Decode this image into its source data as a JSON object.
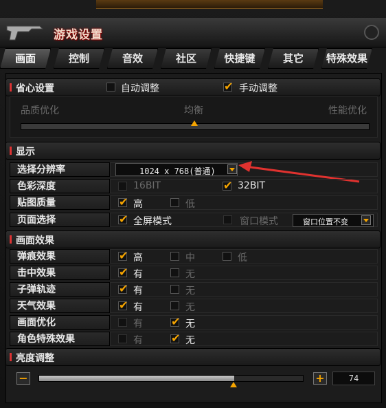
{
  "window": {
    "title": "游戏设置"
  },
  "tabs": [
    "画面",
    "控制",
    "音效",
    "社区",
    "快捷键",
    "其它",
    "特殊效果"
  ],
  "preset": {
    "header": "省心设置",
    "auto_label": "自动调整",
    "manual_label": "手动调整",
    "auto_checked": false,
    "manual_checked": true,
    "quality_label": "品质优化",
    "balance_label": "均衡",
    "performance_label": "性能优化",
    "slider_level": 0.5
  },
  "display": {
    "header": "显示",
    "resolution_label": "选择分辨率",
    "resolution_value": "1024 x 768(普通)",
    "color_depth_label": "色彩深度",
    "color_16": "16BIT",
    "color_32": "32BIT",
    "texture_label": "贴图质量",
    "texture_high": "高",
    "texture_low": "低",
    "screen_mode_label": "页面选择",
    "fullscreen": "全屏模式",
    "windowed": "窗口模式",
    "window_position": "窗口位置不变"
  },
  "effects": {
    "header": "画面效果",
    "rows": [
      {
        "label": "弹痕效果",
        "opt1": "高",
        "opt2": "中",
        "opt3": "低"
      },
      {
        "label": "击中效果",
        "opt1": "有",
        "opt2": "无"
      },
      {
        "label": "子弹轨迹",
        "opt1": "有",
        "opt2": "无"
      },
      {
        "label": "天气效果",
        "opt1": "有",
        "opt2": "无"
      },
      {
        "label": "画面优化",
        "opt1": "有",
        "opt2": "无"
      },
      {
        "label": "角色特殊效果",
        "opt1": "有",
        "opt2": "无"
      }
    ]
  },
  "brightness": {
    "header": "亮度调整",
    "minus": "−",
    "plus": "+",
    "value": "74",
    "level": 0.74
  },
  "colors": {
    "accent": "#f5a400",
    "title_red": "#cc2222"
  }
}
